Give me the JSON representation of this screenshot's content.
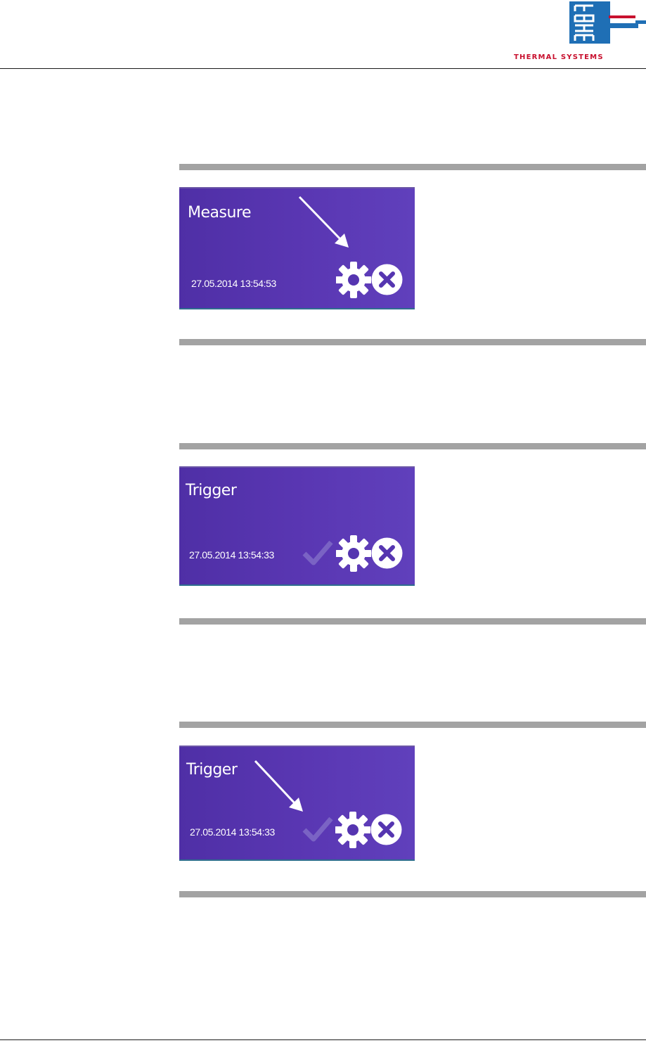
{
  "header": {
    "logo_text": "rehm",
    "logo_caption": "THERMAL SYSTEMS"
  },
  "tiles": [
    {
      "title": "Measure",
      "timestamp": "27.05.2014 13:54:53",
      "check_visible": false
    },
    {
      "title": "Trigger",
      "timestamp": "27.05.2014 13:54:33",
      "check_visible": true
    },
    {
      "title": "Trigger",
      "timestamp": "27.05.2014 13:54:33",
      "check_visible": true
    }
  ],
  "icons": [
    "gear-icon",
    "close-circle-icon",
    "checkmark-icon",
    "arrow-pointer-icon"
  ],
  "colors": {
    "tile_bg": "#5535b0",
    "separator": "#a3a3a3",
    "brand_red": "#c8102e",
    "brand_blue": "#1f6fb5"
  }
}
